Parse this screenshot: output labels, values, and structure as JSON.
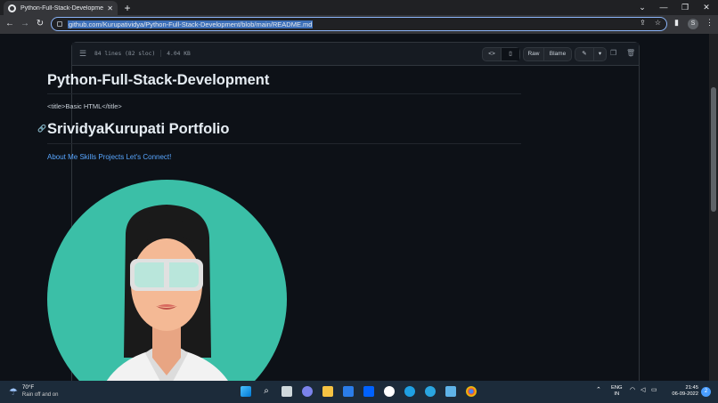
{
  "browser": {
    "tab_title": "Python-Full-Stack-Development/",
    "tab_close": "✕",
    "new_tab": "+",
    "url": "github.com/Kurupatividya/Python-Full-Stack-Development/blob/main/README.md",
    "profile_initial": "S",
    "window_controls": [
      "⌄",
      "—",
      "❐",
      "✕"
    ]
  },
  "file_header": {
    "meta_lines": "84 lines (82 sloc)",
    "meta_size": "4.04 KB",
    "raw_label": "Raw",
    "blame_label": "Blame"
  },
  "readme": {
    "title": "Python-Full-Stack-Development",
    "code_line": "<title>Basic HTML</title>",
    "heading": "SrividyaKurupati Portfolio",
    "links": "About Me Skills Projects Let's Connect!"
  },
  "taskbar": {
    "temperature": "70°F",
    "weather_desc": "Rain off and on",
    "lang_line1": "ENG",
    "lang_line2": "IN",
    "time": "21:45",
    "date": "06-09-2022",
    "notif_count": "2"
  },
  "colors": {
    "portrait_bg": "#3bbfa7",
    "link": "#58a6ff",
    "page_bg": "#0d1117"
  }
}
